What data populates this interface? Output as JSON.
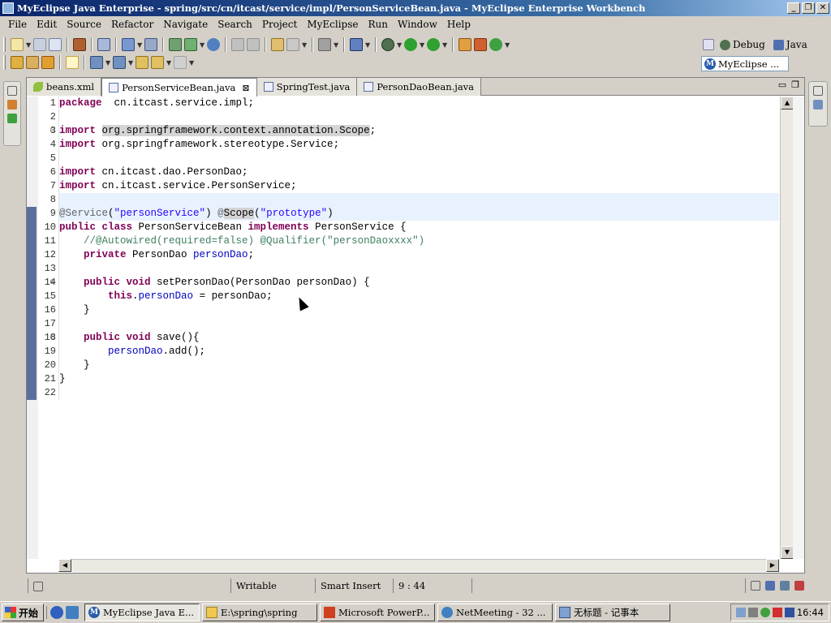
{
  "window": {
    "title": "MyEclipse Java Enterprise - spring/src/cn/itcast/service/impl/PersonServiceBean.java - MyEclipse Enterprise Workbench",
    "minimize": "_",
    "maximize": "❐",
    "close": "✕"
  },
  "menu": [
    "File",
    "Edit",
    "Source",
    "Refactor",
    "Navigate",
    "Search",
    "Project",
    "MyEclipse",
    "Run",
    "Window",
    "Help"
  ],
  "perspectives": {
    "debug": "Debug",
    "java": "Java",
    "active": "MyEclipse ..."
  },
  "tabs": [
    {
      "label": "beans.xml",
      "active": false
    },
    {
      "label": "PersonServiceBean.java",
      "active": true
    },
    {
      "label": "SpringTest.java",
      "active": false
    },
    {
      "label": "PersonDaoBean.java",
      "active": false
    }
  ],
  "code": {
    "line_numbers": [
      "1",
      "2",
      "3",
      "4",
      "5",
      "6",
      "7",
      "8",
      "9",
      "10",
      "11",
      "12",
      "13",
      "14",
      "15",
      "16",
      "17",
      "18",
      "19",
      "20",
      "21",
      "22"
    ]
  },
  "status": {
    "writable": "Writable",
    "insert_mode": "Smart Insert",
    "position": "9 : 44"
  },
  "taskbar": {
    "start": "开始",
    "tasks": [
      {
        "label": "MyEclipse Java E...",
        "pressed": true
      },
      {
        "label": "E:\\spring\\spring",
        "pressed": false
      },
      {
        "label": "Microsoft PowerP...",
        "pressed": false
      },
      {
        "label": "NetMeeting - 32 ...",
        "pressed": false
      },
      {
        "label": "无标题 - 记事本",
        "pressed": false
      }
    ],
    "clock": "16:44"
  }
}
